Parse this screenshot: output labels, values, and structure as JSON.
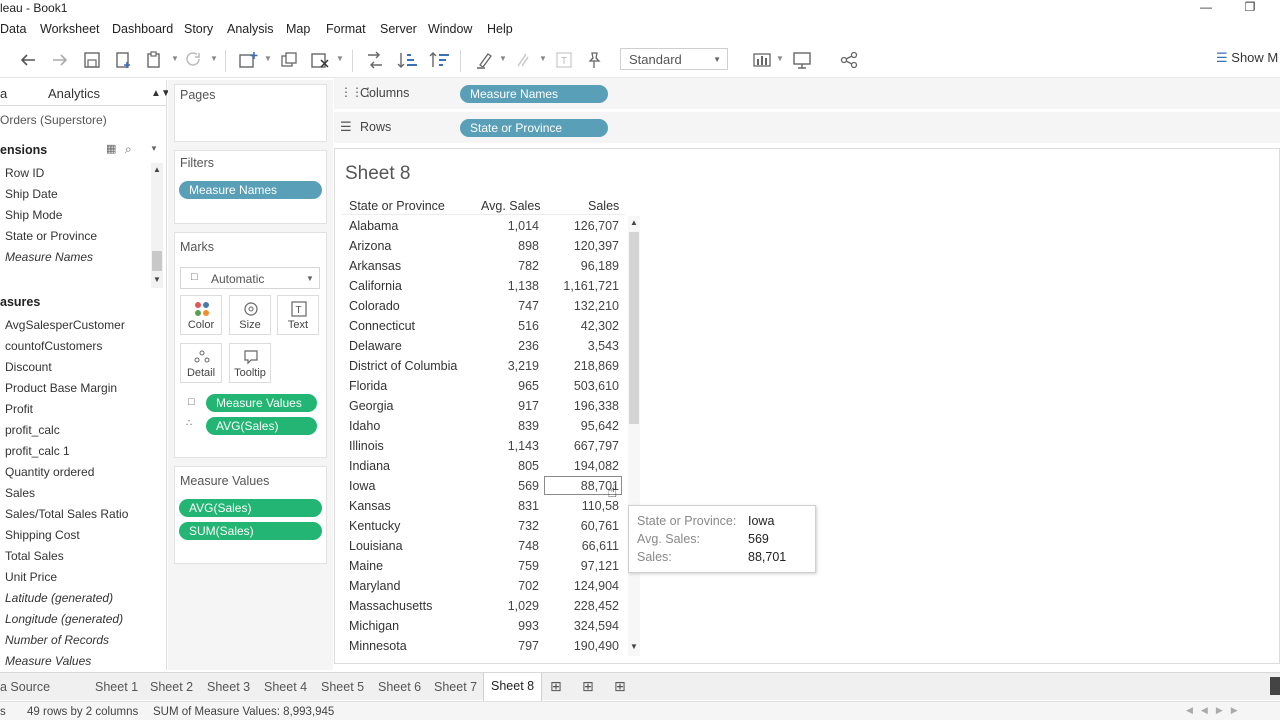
{
  "window": {
    "title": "leau - Book1"
  },
  "menu": [
    "Data",
    "Worksheet",
    "Dashboard",
    "Story",
    "Analysis",
    "Map",
    "Format",
    "Server",
    "Window",
    "Help"
  ],
  "toolbar": {
    "fit_value": "Standard",
    "show_me": "Show M"
  },
  "data_pane": {
    "tabs": {
      "data": "a",
      "analytics": "Analytics"
    },
    "datasource": "Orders (Superstore)",
    "dimensions_header": "ensions",
    "dimensions": [
      "Row ID",
      "Ship Date",
      "Ship Mode",
      "State or Province",
      "Measure Names"
    ],
    "measures_header": "asures",
    "measures": [
      "AvgSalesperCustomer",
      "countofCustomers",
      "Discount",
      "Product Base Margin",
      "Profit",
      "profit_calc",
      "profit_calc 1",
      "Quantity ordered",
      "Sales",
      "Sales/Total Sales Ratio",
      "Shipping Cost",
      "Total Sales",
      "Unit Price",
      "Latitude (generated)",
      "Longitude (generated)",
      "Number of Records",
      "Measure Values"
    ]
  },
  "cards": {
    "pages": "Pages",
    "filters": "Filters",
    "filter_pill": "Measure Names",
    "marks": "Marks",
    "mark_type": "Automatic",
    "mark_buttons": [
      "Color",
      "Size",
      "Text",
      "Detail",
      "Tooltip"
    ],
    "mark_pills": [
      "Measure Values",
      "AVG(Sales)"
    ],
    "measure_values_title": "Measure Values",
    "measure_values_pills": [
      "AVG(Sales)",
      "SUM(Sales)"
    ]
  },
  "shelves": {
    "columns_label": "Columns",
    "columns_pill": "Measure Names",
    "rows_label": "Rows",
    "rows_pill": "State or Province"
  },
  "sheet": {
    "title": "Sheet 8",
    "headers": [
      "State or Province",
      "Avg. Sales",
      "Sales"
    ],
    "rows": [
      {
        "state": "Alabama",
        "avg": "1,014",
        "sales": "126,707"
      },
      {
        "state": "Arizona",
        "avg": "898",
        "sales": "120,397"
      },
      {
        "state": "Arkansas",
        "avg": "782",
        "sales": "96,189"
      },
      {
        "state": "California",
        "avg": "1,138",
        "sales": "1,161,721"
      },
      {
        "state": "Colorado",
        "avg": "747",
        "sales": "132,210"
      },
      {
        "state": "Connecticut",
        "avg": "516",
        "sales": "42,302"
      },
      {
        "state": "Delaware",
        "avg": "236",
        "sales": "3,543"
      },
      {
        "state": "District of Columbia",
        "avg": "3,219",
        "sales": "218,869"
      },
      {
        "state": "Florida",
        "avg": "965",
        "sales": "503,610"
      },
      {
        "state": "Georgia",
        "avg": "917",
        "sales": "196,338"
      },
      {
        "state": "Idaho",
        "avg": "839",
        "sales": "95,642"
      },
      {
        "state": "Illinois",
        "avg": "1,143",
        "sales": "667,797"
      },
      {
        "state": "Indiana",
        "avg": "805",
        "sales": "194,082"
      },
      {
        "state": "Iowa",
        "avg": "569",
        "sales": "88,701"
      },
      {
        "state": "Kansas",
        "avg": "831",
        "sales": "110,58"
      },
      {
        "state": "Kentucky",
        "avg": "732",
        "sales": "60,761"
      },
      {
        "state": "Louisiana",
        "avg": "748",
        "sales": "66,611"
      },
      {
        "state": "Maine",
        "avg": "759",
        "sales": "97,121"
      },
      {
        "state": "Maryland",
        "avg": "702",
        "sales": "124,904"
      },
      {
        "state": "Massachusetts",
        "avg": "1,029",
        "sales": "228,452"
      },
      {
        "state": "Michigan",
        "avg": "993",
        "sales": "324,594"
      },
      {
        "state": "Minnesota",
        "avg": "797",
        "sales": "190,490"
      }
    ]
  },
  "tooltip": {
    "rows": [
      {
        "key": "State or Province:",
        "value": "Iowa"
      },
      {
        "key": "Avg. Sales:",
        "value": "569"
      },
      {
        "key": "Sales:",
        "value": "88,701"
      }
    ]
  },
  "sheet_tabs": {
    "datasource": "a Source",
    "tabs": [
      "Sheet 1",
      "Sheet 2",
      "Sheet 3",
      "Sheet 4",
      "Sheet 5",
      "Sheet 6",
      "Sheet 7",
      "Sheet 8"
    ],
    "active": "Sheet 8"
  },
  "status": {
    "marks": "s",
    "rows_cols": "49 rows by 2 columns",
    "sum": "SUM of Measure Values: 8,993,945"
  },
  "colors": {
    "dimension_pill": "#4d9fba",
    "measure_pill": "#22b573",
    "brand_blue": "#3b6fb6"
  }
}
